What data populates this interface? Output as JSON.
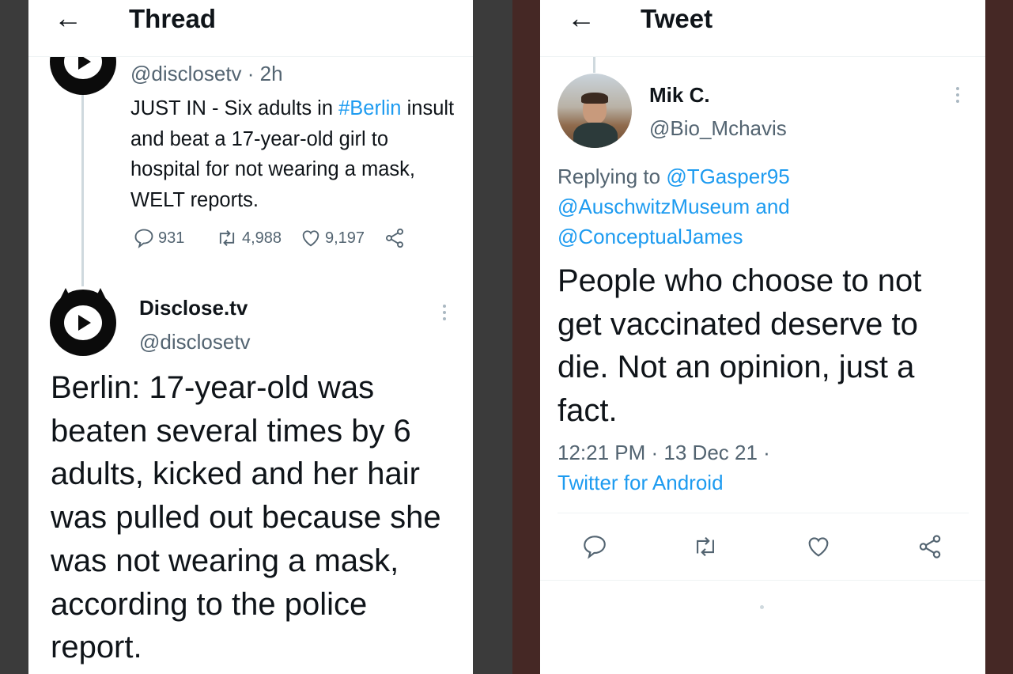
{
  "left": {
    "header": {
      "back_icon": "arrow-left-icon",
      "title": "Thread"
    },
    "prev_tweet": {
      "handle_time": "@disclosetv · 2h",
      "text_before": "JUST IN - Six adults in ",
      "hashtag": "#Berlin",
      "text_after": "insult and beat a 17-year-old girl to hospital for not wearing a mask, WELT reports.",
      "stats": {
        "replies": "931",
        "retweets": "4,988",
        "likes": "9,197"
      }
    },
    "main_tweet": {
      "display_name": "Disclose.tv",
      "handle": "@disclosetv",
      "text": "Berlin: 17-year-old was beaten several times by 6 adults, kicked and her hair was pulled out because she was not wearing a mask, according to the police report."
    }
  },
  "right": {
    "header": {
      "back_icon": "arrow-left-icon",
      "title": "Tweet"
    },
    "tweet": {
      "display_name": "Mik C.",
      "handle": "@Bio_Mchavis",
      "replying_to_label": "Replying to ",
      "mention_1": "@TGasper95",
      "mention_2": "@AuschwitzMuseum",
      "and_label": " and",
      "mention_3": "@ConceptualJames",
      "text": "People who choose to not get vaccinated deserve to die. Not an opinion, just a fact.",
      "timestamp": "12:21 PM · 13 Dec 21 ·",
      "source": "Twitter for Android"
    },
    "actions": [
      "reply-icon",
      "retweet-icon",
      "like-icon",
      "share-icon"
    ]
  },
  "colors": {
    "link": "#1d9bf0",
    "muted": "#536471",
    "text": "#0f1419"
  }
}
